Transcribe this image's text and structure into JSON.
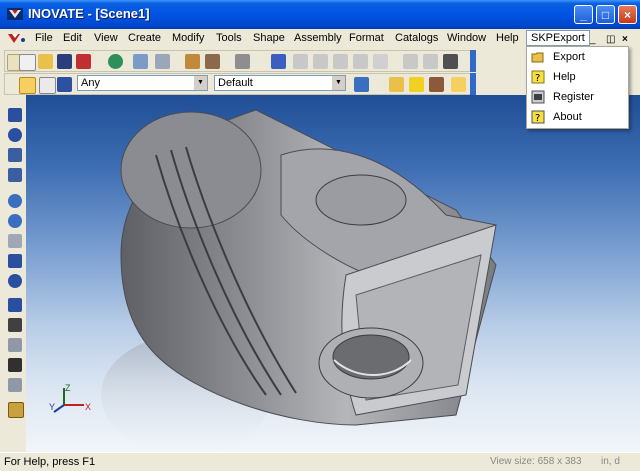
{
  "window": {
    "title": "INOVATE - [Scene1]",
    "buttons": {
      "minimize": "_",
      "maximize": "□",
      "close": "×"
    }
  },
  "menubar": {
    "items": [
      "File",
      "Edit",
      "View",
      "Create",
      "Modify",
      "Tools",
      "Shape",
      "Assembly",
      "Format",
      "Catalogs",
      "Window",
      "Help",
      "SKPExport"
    ],
    "active": "SKPExport",
    "mdi_controls": {
      "minimize": "_",
      "restore": "◫",
      "close": "×"
    }
  },
  "toolbar_row2": {
    "icons": [
      "new-icon",
      "open-icon",
      "save-icon",
      "help-pointer-icon",
      "globe-icon",
      "scene-icon",
      "scene2-icon",
      "cylinder-icon",
      "cylinder2-icon",
      "cylinder3-icon",
      "undo-icon",
      "redo-icon",
      "cut-icon",
      "copy-icon",
      "paste-icon",
      "paint-icon",
      "eraser-icon",
      "camera-icon",
      "camera2-icon",
      "camera3-icon"
    ]
  },
  "toolbar_row3": {
    "filter_combo": "Any",
    "style_combo": "Default",
    "icons": [
      "select-arrow-icon",
      "select-pointer-icon",
      "car-icon",
      "tree-icon",
      "folder-icon",
      "help-icon",
      "catalog-icon",
      "catalog2-icon"
    ]
  },
  "left_toolbar": {
    "icons": [
      "pan-icon",
      "rotate-icon",
      "walk-icon",
      "spin-icon",
      "zoom-icon",
      "zoom-window-icon",
      "zoom-extent-icon",
      "fit-icon",
      "view-icon",
      "light-icon",
      "camera-icon",
      "render-icon",
      "render2-icon",
      "render3-icon",
      "shading-icon"
    ]
  },
  "skpexport_menu": {
    "items": [
      {
        "label": "Export",
        "icon": "folder-open-icon"
      },
      {
        "label": "Help",
        "icon": "help-icon"
      },
      {
        "label": "Register",
        "icon": "register-icon"
      },
      {
        "label": "About",
        "icon": "about-icon"
      }
    ]
  },
  "axis_indicator": {
    "x": "X",
    "y": "Y",
    "z": "Z"
  },
  "statusbar": {
    "text": "For Help, press F1",
    "view_size": "View size:  658 x 383",
    "units": "in, d"
  },
  "colors": {
    "titlebar": "#0054E3",
    "viewport_top": "#1F4E96",
    "viewport_bottom": "#F2F5F9",
    "model_gray": "#8C8E93",
    "menu_active_border": "#7F9DB9"
  }
}
